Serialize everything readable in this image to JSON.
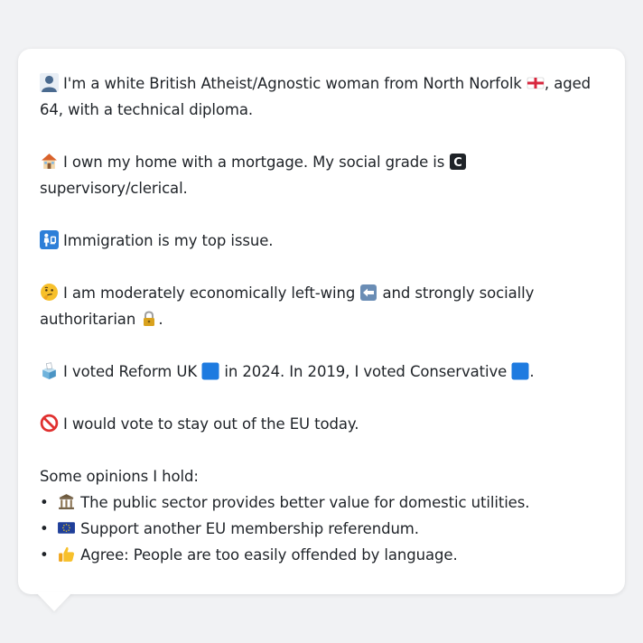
{
  "profile": {
    "intro": {
      "icon": "person-silhouette-icon",
      "text_before_flag": "I'm a white British Atheist/Agnostic woman from North Norfolk",
      "flag_icon": "england-flag-icon",
      "text_after_flag": ", aged 64, with a technical diploma."
    },
    "housing": {
      "icon": "house-icon",
      "text_before_grade": "I own my home with a mortgage. My social grade is",
      "grade_icon": "letter-c-icon",
      "grade_letter": "C",
      "text_after_grade": "supervisory/clerical."
    },
    "top_issue": {
      "icon": "passport-control-icon",
      "text": "Immigration is my top issue."
    },
    "politics": {
      "icon": "thinking-face-icon",
      "text_part1": "I am moderately economically left-wing",
      "left_icon": "left-arrow-icon",
      "text_part2": "and strongly socially authoritarian",
      "lock_icon": "lock-icon",
      "text_end": "."
    },
    "voting": {
      "icon": "ballot-box-icon",
      "text_part1": "I voted Reform UK",
      "square1_icon": "blue-square-icon",
      "text_part2": "in 2024. In 2019, I voted Conservative",
      "square2_icon": "blue-square-icon",
      "text_end": "."
    },
    "eu": {
      "icon": "prohibited-icon",
      "text": "I would vote to stay out of the EU today."
    },
    "opinions": {
      "title": "Some opinions I hold:",
      "bullet": "•",
      "items": [
        {
          "icon": "classical-building-icon",
          "text": "The public sector provides better value for domestic utilities."
        },
        {
          "icon": "eu-flag-icon",
          "text": "Support another EU membership referendum."
        },
        {
          "icon": "thumbs-up-icon",
          "text": "Agree: People are too easily offended by language."
        }
      ]
    }
  },
  "colors": {
    "background": "#f1f2f4",
    "bubble": "#ffffff",
    "text": "#1f2328",
    "blue_square": "#1e7be0"
  }
}
